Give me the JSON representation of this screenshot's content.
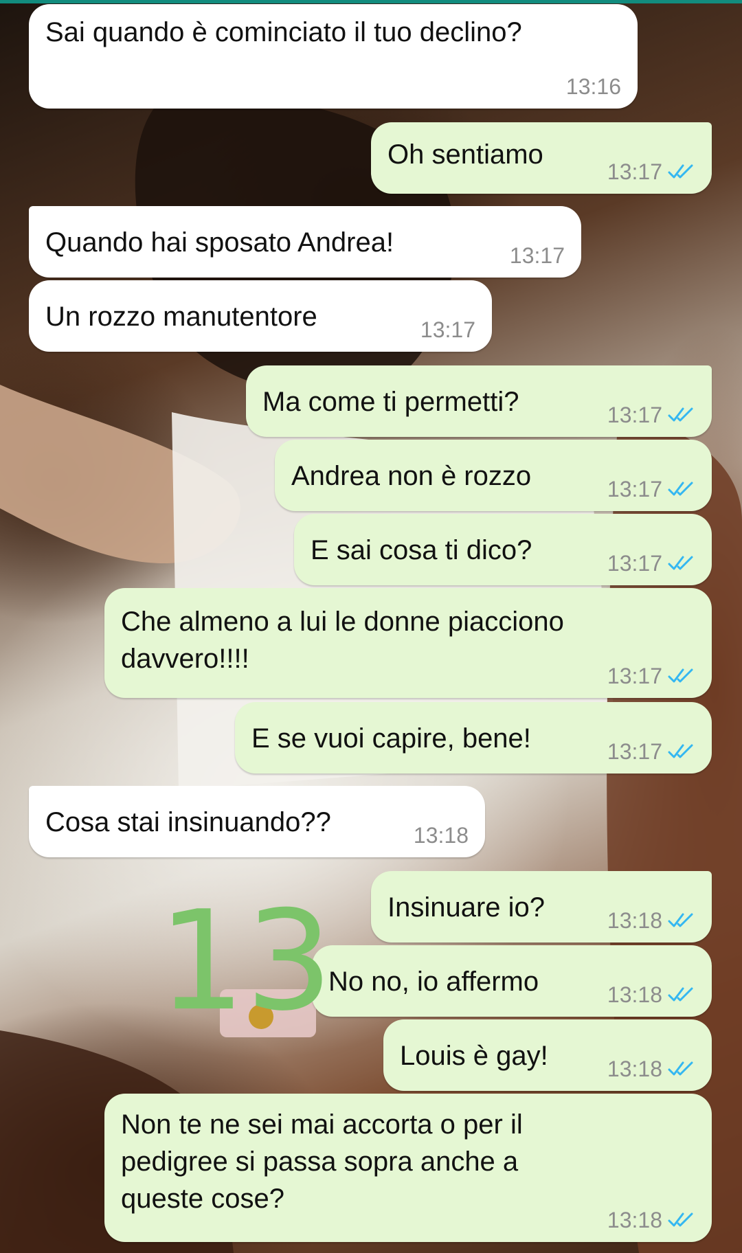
{
  "chat": {
    "messages": [
      {
        "direction": "in",
        "text": "Sai quando è cominciato il tuo declino?",
        "time": "13:16"
      },
      {
        "direction": "out",
        "text": "Oh sentiamo",
        "time": "13:17",
        "status": "read"
      },
      {
        "direction": "in",
        "text": "Quando hai sposato Andrea!",
        "time": "13:17"
      },
      {
        "direction": "in",
        "text": "Un rozzo manutentore",
        "time": "13:17"
      },
      {
        "direction": "out",
        "text": "Ma come ti permetti?",
        "time": "13:17",
        "status": "read"
      },
      {
        "direction": "out",
        "text": "Andrea non è rozzo",
        "time": "13:17",
        "status": "read"
      },
      {
        "direction": "out",
        "text": "E sai cosa ti dico?",
        "time": "13:17",
        "status": "read"
      },
      {
        "direction": "out",
        "text": "Che almeno a lui le donne piacciono\ndavvero!!!!",
        "time": "13:17",
        "status": "read"
      },
      {
        "direction": "out",
        "text": "E se vuoi capire, bene!",
        "time": "13:17",
        "status": "read"
      },
      {
        "direction": "in",
        "text": "Cosa stai insinuando??",
        "time": "13:18"
      },
      {
        "direction": "out",
        "text": "Insinuare io?",
        "time": "13:18",
        "status": "read"
      },
      {
        "direction": "out",
        "text": "No no, io affermo",
        "time": "13:18",
        "status": "read"
      },
      {
        "direction": "out",
        "text": "Louis è gay!",
        "time": "13:18",
        "status": "read"
      },
      {
        "direction": "out",
        "text": "Non te ne sei mai accorta o per il\npedigree si passa sopra anche a\nqueste cose?",
        "time": "13:18",
        "status": "read"
      }
    ]
  },
  "annotation": {
    "text": "13",
    "color": "#7cc46a"
  },
  "colors": {
    "incoming_bubble": "#ffffff",
    "outgoing_bubble": "#e5f7d3",
    "read_ticks": "#34b7f1",
    "timestamp": "#8c8c8c"
  },
  "icons": {
    "status_read": "double-check-icon"
  }
}
